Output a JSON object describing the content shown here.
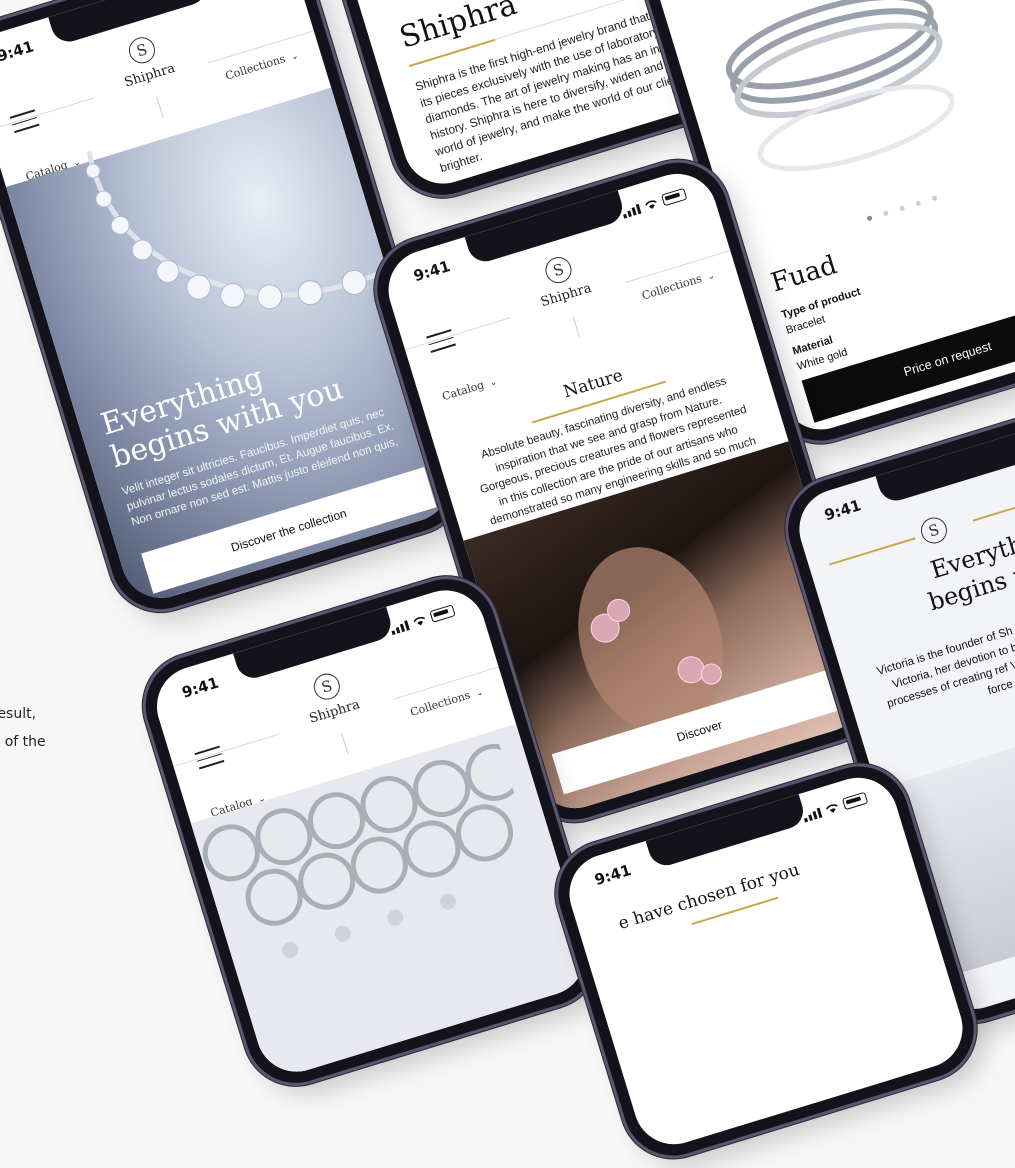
{
  "caption": {
    "line1": "result,",
    "line2": "y of the"
  },
  "status": {
    "time": "9:41"
  },
  "brand": {
    "name": "Shiphra",
    "logo_glyph": "S"
  },
  "nav": {
    "catalog": "Catalog",
    "collections": "Collections"
  },
  "hero": {
    "title_line1": "Everything",
    "title_line2": "begins with you",
    "body": "Velit integer sit ultricies. Faucibus. Imperdiet quis, nec pulvinar lectus sodales dictum, Et. Augue faucibus. Ex. Non ornare non sed est. Mattis justo eleifend non quis,",
    "button": "Discover the collection"
  },
  "about": {
    "title": "Shiphra",
    "body": "Shiphra is the first high-end jewelry brand that creates its pieces exclusively with the use of laboratory-grown diamonds. The art of jewelry making has an inspiring history. Shiphra is here to diversify, widen and enrich the world of jewelry, and make the world of our clients brighter."
  },
  "product": {
    "name": "Fuad",
    "type_label": "Type of product",
    "type_value": "Bracelet",
    "material_label": "Material",
    "material_value": "White gold",
    "button": "Price on request"
  },
  "nature": {
    "title": "Nature",
    "body": "Absolute beauty, fascinating diversity, and endless inspiration that we see and grasp from Nature. Gorgeous, precious creatures and flowers represented in this collection are the pride of our artisans who demonstrated so many engineering skills and so much thinking to make those intricate shapes. The lively movements of the pieces show their natural delicacy.",
    "button": "Discover"
  },
  "victoria": {
    "title_line1": "Everythin",
    "title_line2": "begins with",
    "body": "Victoria is the founder of Sh her second name. Everythi Victoria, her devotion to b details and involvement i processes of creating ref Victoria's dedication to driving force behind Sh"
  },
  "chosen": {
    "title": "e have chosen for you"
  },
  "colors": {
    "gold_accent": "#c9a64c",
    "frame": "#14131c",
    "button_dark": "#0b0b0b"
  }
}
